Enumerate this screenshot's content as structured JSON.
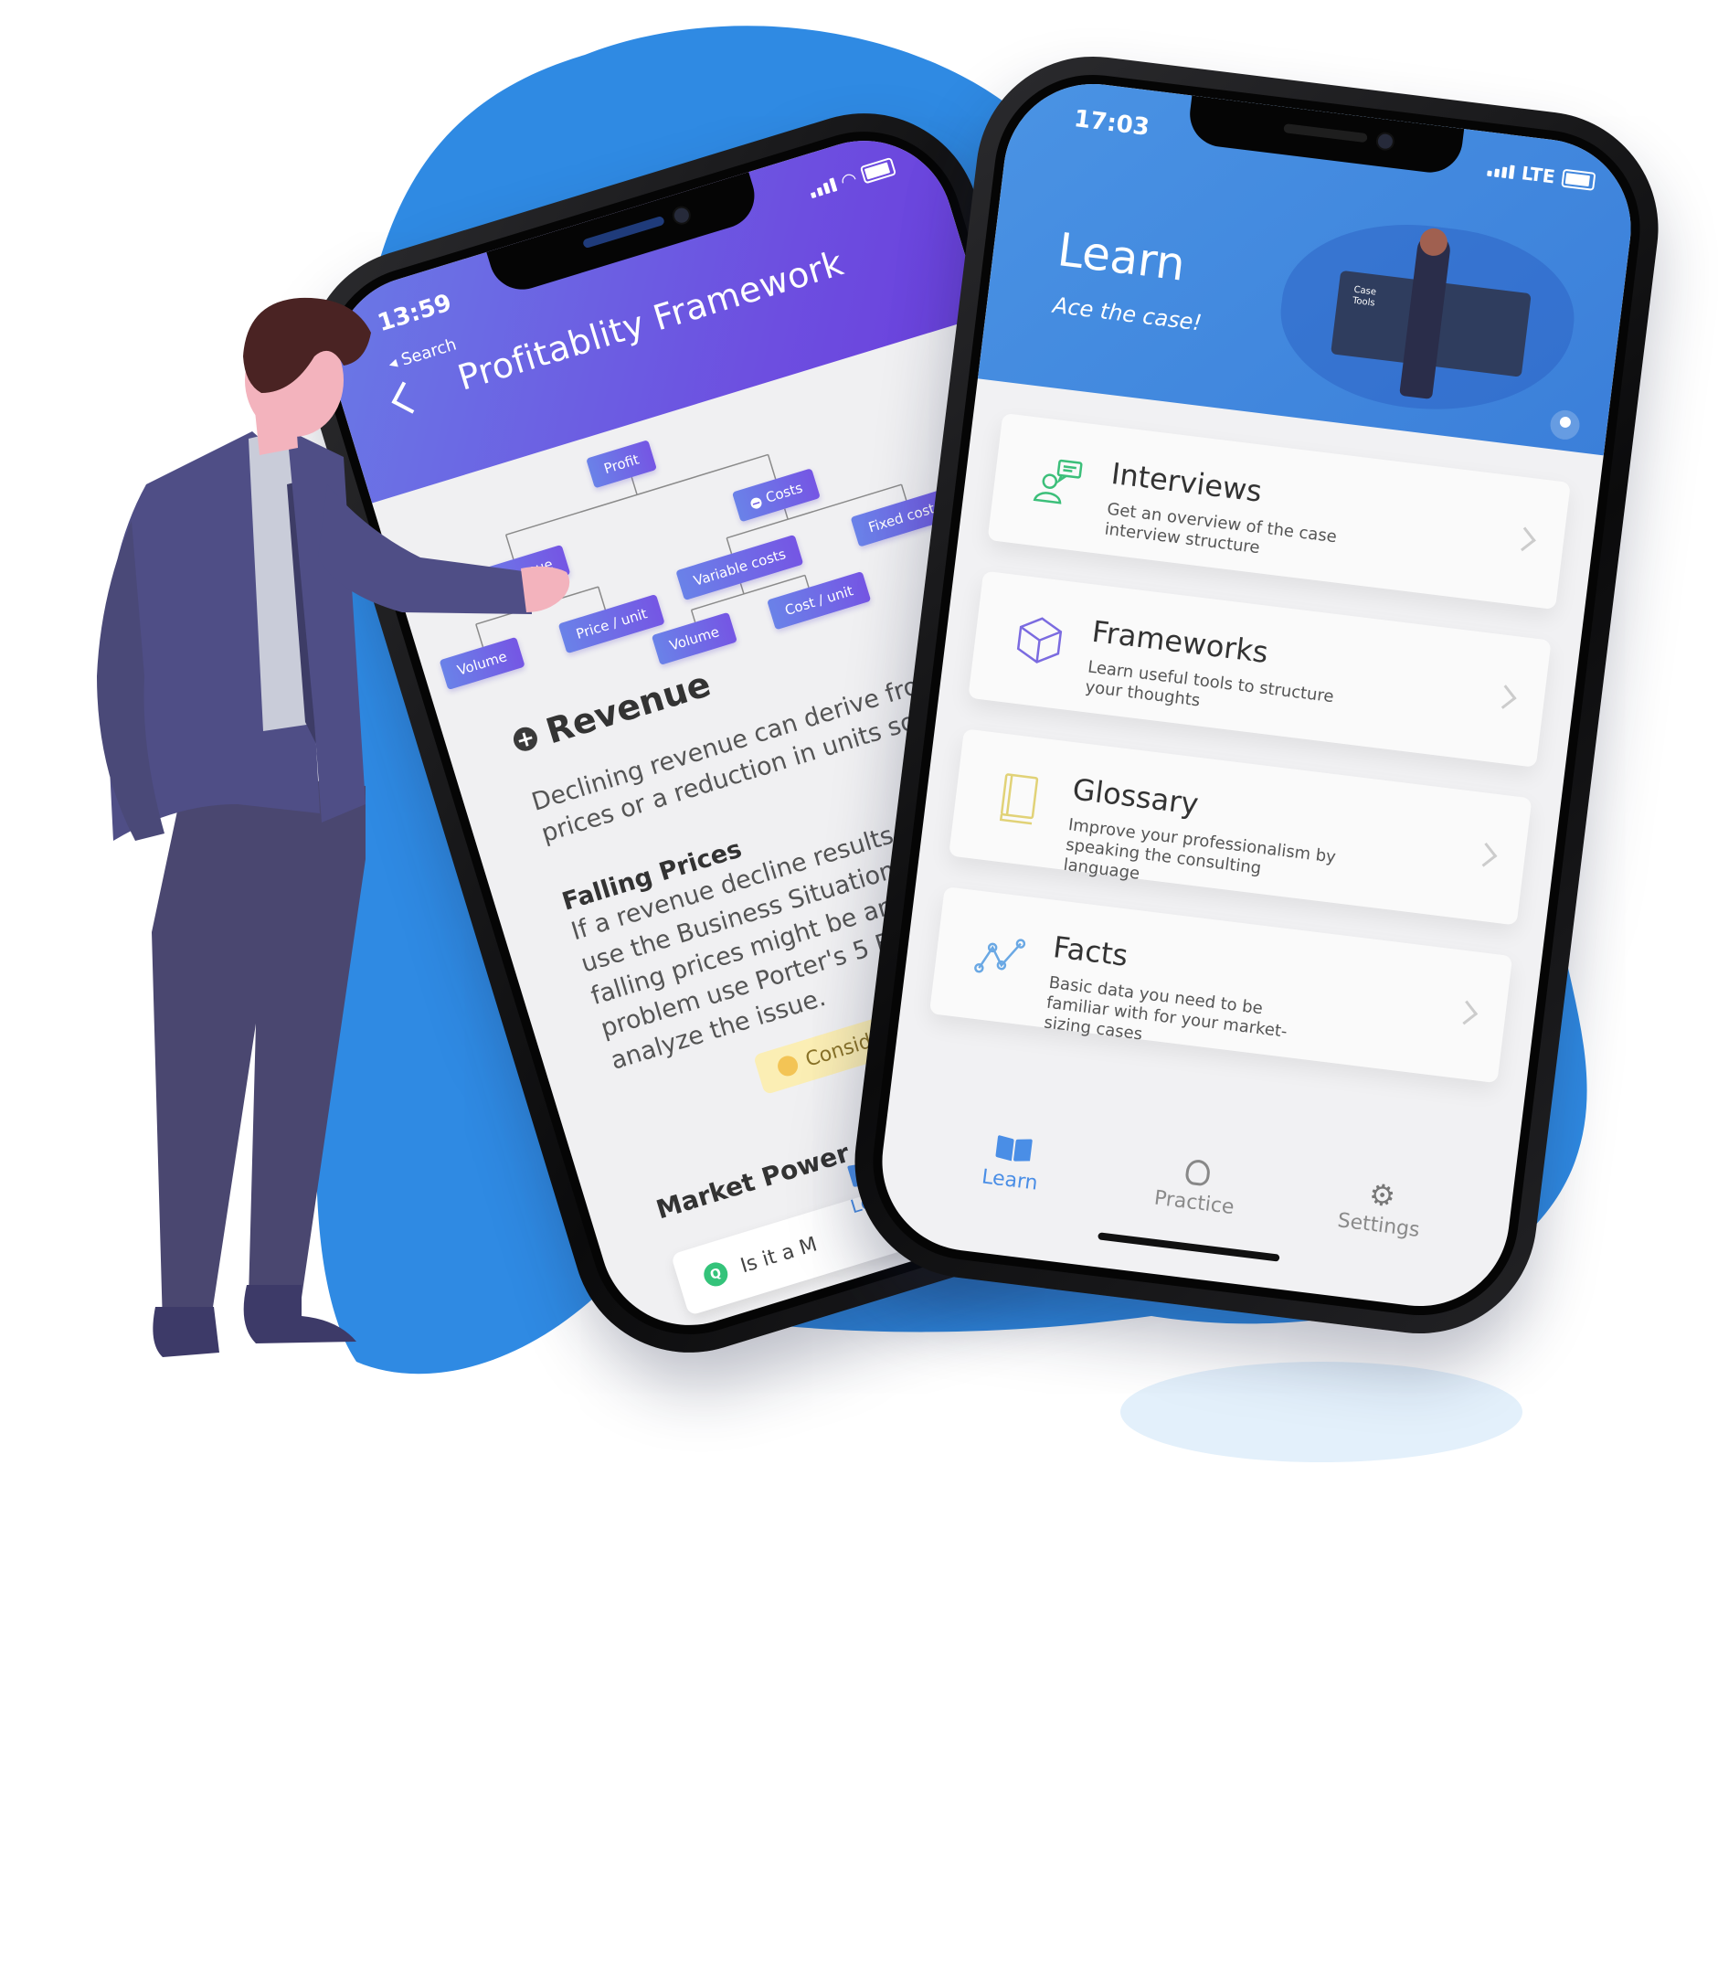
{
  "colors": {
    "blob": "#2f8ae3",
    "purple_header": "#6d4ee0",
    "learn_header": "#4a93e4",
    "suit": "#4f4e86",
    "accent": "#4a8ee6"
  },
  "back_phone": {
    "time": "13:59",
    "back_label": "◂ Search",
    "title": "Profitablity Framework",
    "tree": {
      "profit": "Profit",
      "costs": "Costs",
      "revenue": "Revenue",
      "variable_costs": "Variable costs",
      "fixed_costs": "Fixed costs",
      "volume_left": "Volume",
      "price_unit": "Price / unit",
      "volume_right": "Volume",
      "cost_unit": "Cost / unit"
    },
    "section_title": "Revenue",
    "intro": "Declining revenue can derive from a decline in prices or a reduction in units sold.",
    "subheading": "Falling Prices",
    "falling_text": "If a revenue decline results from falling prices use the Business Situation Framework or if falling prices might be an industry-wide problem use Porter's 5 Forces Framework to analyze the issue.",
    "consider_label": "Consider",
    "subheading2": "Market Power",
    "search_card_text": "Is it a M",
    "tab_label": "Learn"
  },
  "front_phone": {
    "time": "17:03",
    "network": "LTE",
    "title": "Learn",
    "subtitle": "Ace the case!",
    "illustration_label": "Case Tools",
    "cards": [
      {
        "icon": "interview-chat-icon",
        "title": "Interviews",
        "desc": "Get an overview of the case interview structure"
      },
      {
        "icon": "cube-icon",
        "title": "Frameworks",
        "desc": "Learn useful tools to structure your thoughts"
      },
      {
        "icon": "book-icon",
        "title": "Glossary",
        "desc": "Improve your professionalism by speaking the consulting language"
      },
      {
        "icon": "graph-icon",
        "title": "Facts",
        "desc": "Basic data you need to be familiar with for your market-sizing cases"
      }
    ],
    "tabs": [
      {
        "icon": "book-icon",
        "label": "Learn"
      },
      {
        "icon": "head-icon",
        "label": "Practice"
      },
      {
        "icon": "gear-icon",
        "label": "Settings"
      }
    ]
  }
}
